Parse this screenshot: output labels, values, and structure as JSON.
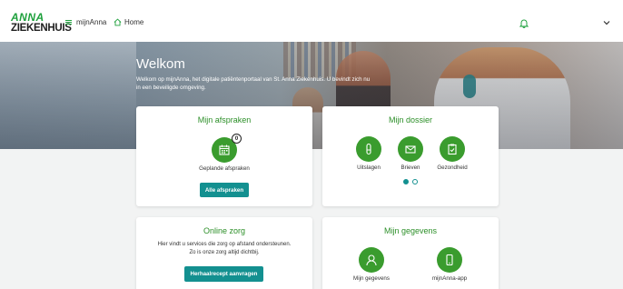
{
  "header": {
    "logo_line1": "ANNA",
    "logo_line2": "ZIEKENHUIS",
    "menu_label": "mijnAnna",
    "home_label": "Home",
    "icons": {
      "menu": "hamburger-icon",
      "home": "home-icon",
      "notifications": "bell-icon",
      "account": "chevron-down-icon"
    },
    "accent_color": "#1ea03c"
  },
  "hero": {
    "title": "Welkom",
    "text": "Welkom op mijnAnna, het digitale patiëntenportaal van St. Anna Ziekenhuis. U bevindt zich nu in een beveiligde omgeving."
  },
  "cards": {
    "afspraken": {
      "title": "Mijn afspraken",
      "badge_count": "0",
      "item_label": "Geplande afspraken",
      "icon": "calendar-icon",
      "button_label": "Alle afspraken"
    },
    "dossier": {
      "title": "Mijn dossier",
      "items": [
        {
          "label": "Uitslagen",
          "icon": "test-tube-icon"
        },
        {
          "label": "Brieven",
          "icon": "envelope-icon"
        },
        {
          "label": "Gezondheid",
          "icon": "clipboard-icon"
        }
      ],
      "pagination": {
        "current_page": 1,
        "total_pages": 2
      }
    },
    "online_zorg": {
      "title": "Online zorg",
      "text_line1": "Hier vindt u services die zorg op afstand ondersteunen.",
      "text_line2": "Zo is onze zorg altijd dichtbij.",
      "button_label": "Herhaalrecept aanvragen"
    },
    "gegevens": {
      "title": "Mijn gegevens",
      "items": [
        {
          "label": "Mijn gegevens",
          "icon": "person-icon"
        },
        {
          "label": "mijnAnna-app",
          "icon": "phone-icon"
        }
      ]
    }
  },
  "colors": {
    "brand_green": "#3a9c2e",
    "title_green": "#2c8f28",
    "button_teal": "#139090",
    "background": "#f2f3f3"
  }
}
